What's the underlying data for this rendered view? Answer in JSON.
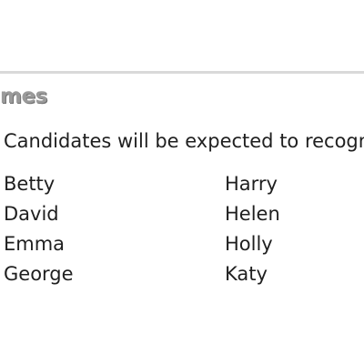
{
  "section": {
    "heading": "mes",
    "intro": "Candidates will be expected to recogn"
  },
  "names": [
    {
      "left": "Betty",
      "right": "Harry"
    },
    {
      "left": "David",
      "right": "Helen"
    },
    {
      "left": "Emma",
      "right": "Holly"
    },
    {
      "left": "George",
      "right": "Katy"
    }
  ]
}
